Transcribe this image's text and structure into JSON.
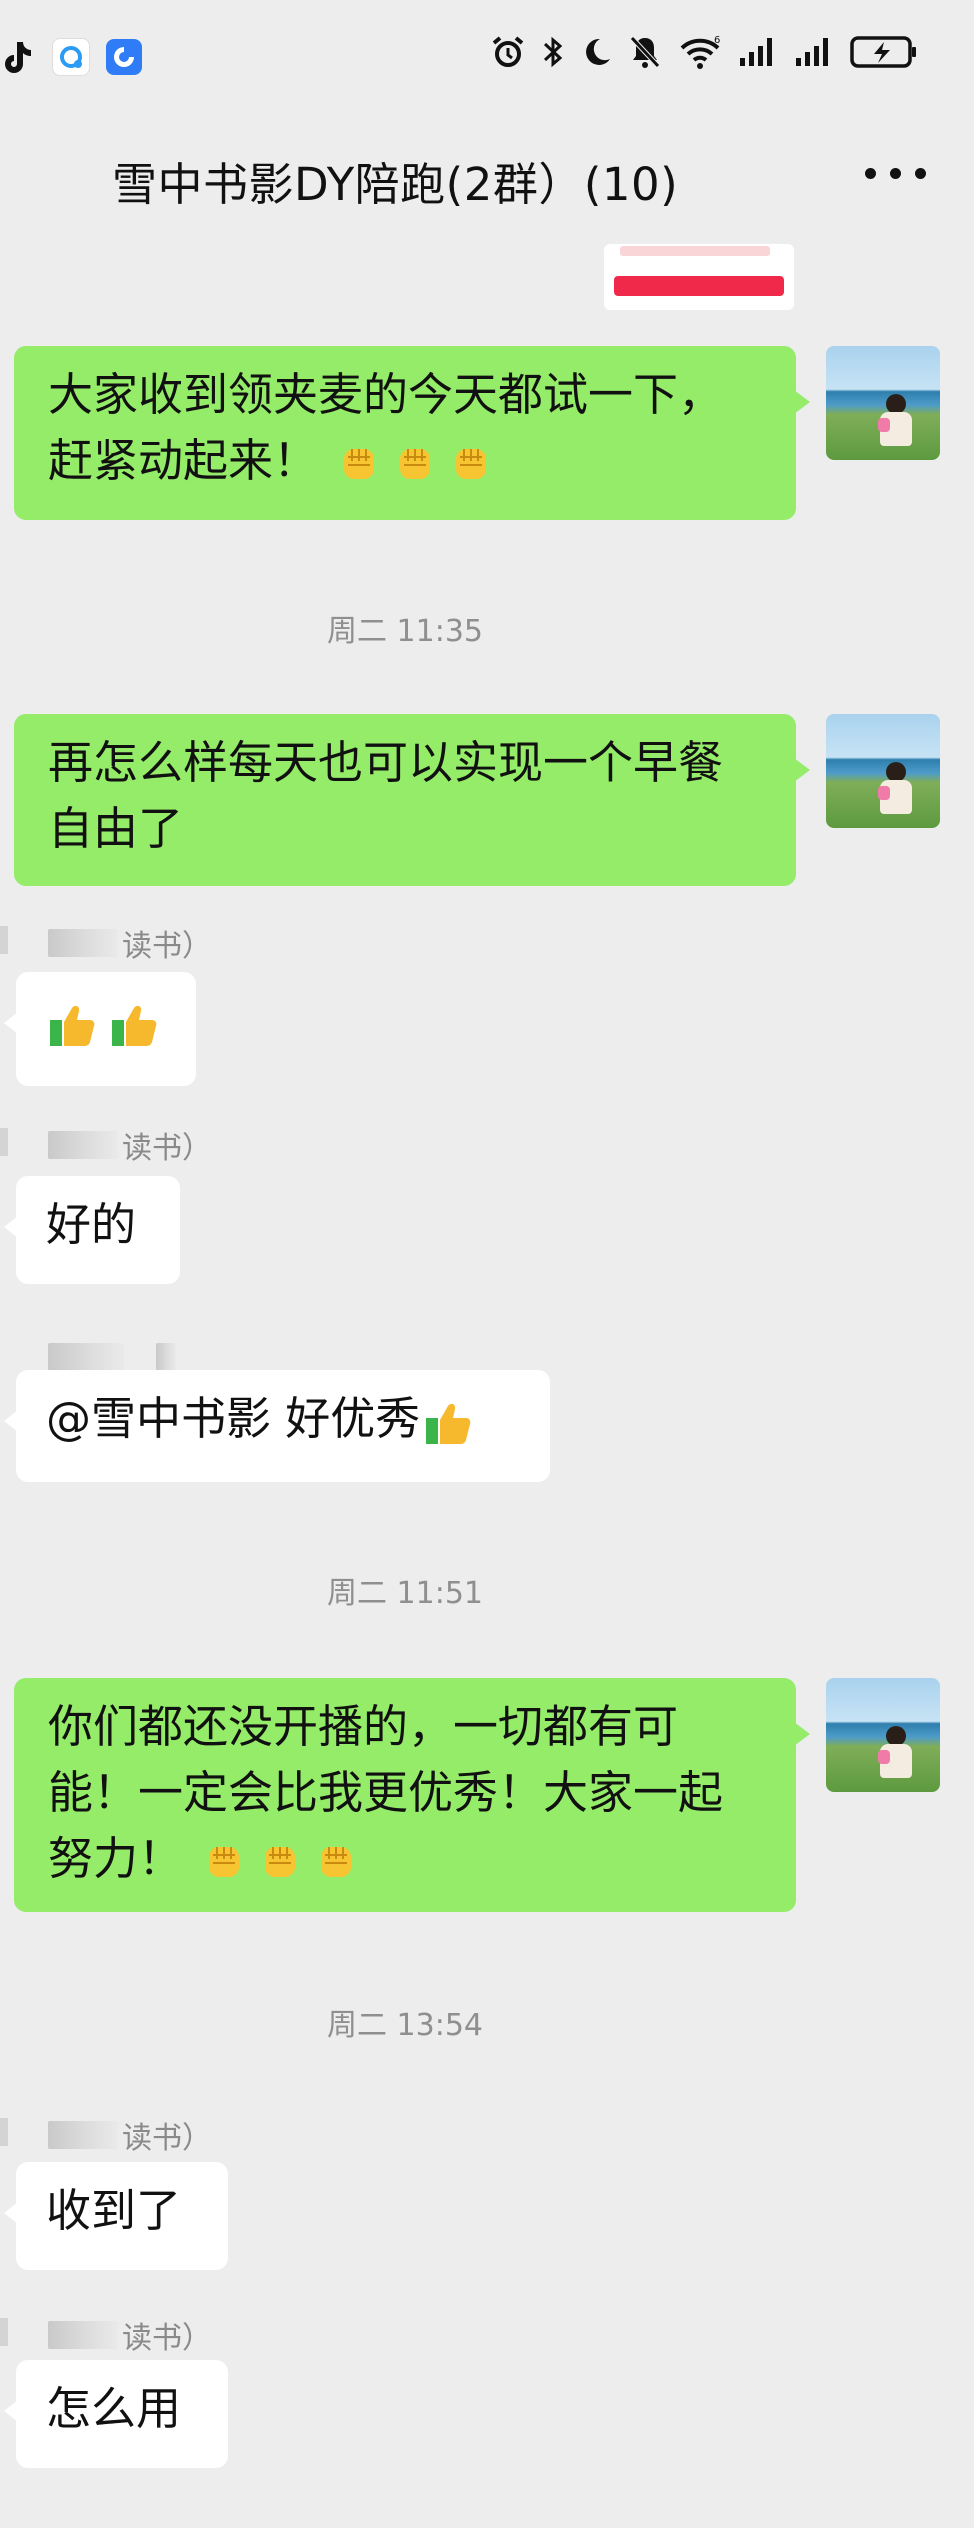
{
  "status_bar": {
    "left_icons": [
      "tiktok-icon",
      "cloud-app-icon",
      "blue-app-icon"
    ],
    "right_icons": [
      "alarm-icon",
      "bluetooth-icon",
      "moon-icon",
      "mute-bell-icon",
      "wifi-icon",
      "signal-icon",
      "signal-icon",
      "battery-charging-icon"
    ]
  },
  "header": {
    "title": "雪中书影DY陪跑(2群）(10)",
    "more_icon": "more-dots-icon"
  },
  "messages": [
    {
      "type": "me",
      "text": "大家收到领夹麦的今天都试一下，赶紧动起来！",
      "emoji": [
        "fist",
        "fist",
        "fist"
      ]
    },
    {
      "type": "time",
      "text": "周二 11:35"
    },
    {
      "type": "me",
      "text": "再怎么样每天也可以实现一个早餐自由了"
    },
    {
      "type": "other",
      "sender": "读书）",
      "emoji": [
        "thumbs-up",
        "thumbs-up"
      ]
    },
    {
      "type": "other",
      "sender": "读书）",
      "text": "好的"
    },
    {
      "type": "other",
      "sender": "",
      "text": "@雪中书影  好优秀",
      "emoji": [
        "thumbs-up"
      ]
    },
    {
      "type": "time",
      "text": "周二 11:51"
    },
    {
      "type": "me",
      "text": "你们都还没开播的，一切都有可能！一定会比我更优秀！大家一起努力！",
      "emoji": [
        "fist",
        "fist",
        "fist"
      ]
    },
    {
      "type": "time",
      "text": "周二 13:54"
    },
    {
      "type": "other",
      "sender": "读书）",
      "text": "收到了"
    },
    {
      "type": "other",
      "sender": "读书）",
      "text": "怎么用"
    }
  ],
  "colors": {
    "my_bubble": "#95ec69",
    "other_bubble": "#ffffff",
    "background": "#ededed"
  }
}
